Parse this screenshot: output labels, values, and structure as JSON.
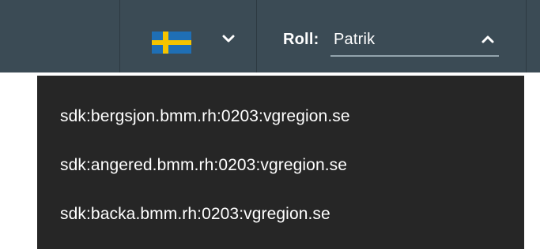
{
  "header": {
    "language": {
      "flag_icon": "swedish-flag-icon",
      "flag_colors": {
        "blue": "#1f6fb5",
        "yellow": "#f5c400"
      },
      "chevron_icon": "chevron-down-icon"
    },
    "role": {
      "label": "Roll:",
      "value": "Patrik",
      "chevron_icon": "chevron-up-icon",
      "expanded": true
    }
  },
  "dropdown": {
    "items": [
      {
        "label": "sdk:bergsjon.bmm.rh:0203:vgregion.se"
      },
      {
        "label": "sdk:angered.bmm.rh:0203:vgregion.se"
      },
      {
        "label": "sdk:backa.bmm.rh:0203:vgregion.se"
      }
    ]
  },
  "colors": {
    "topbar_bg": "#3b4b55",
    "dropdown_bg": "#262626",
    "text": "#ffffff"
  }
}
